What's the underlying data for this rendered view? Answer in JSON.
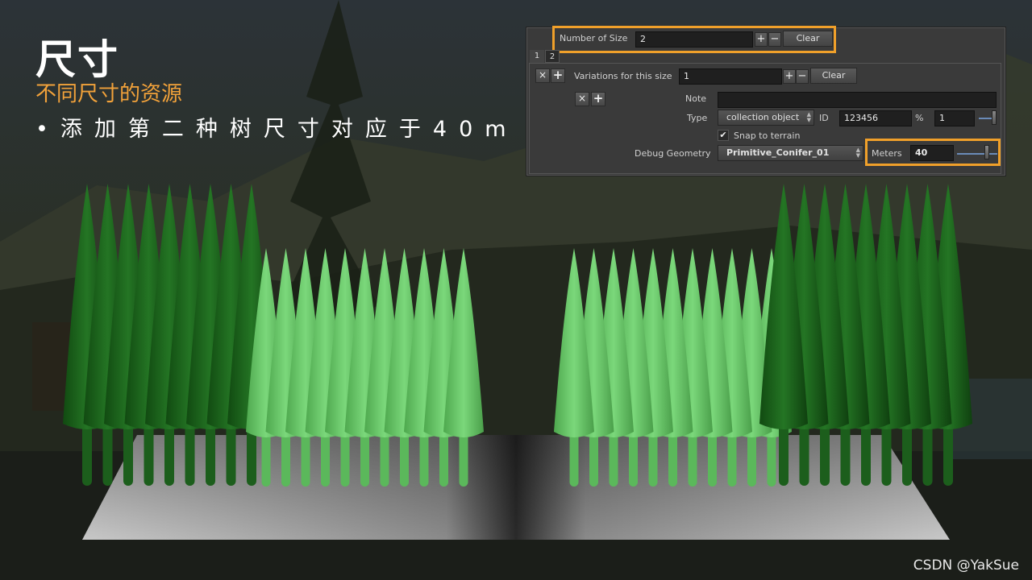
{
  "slide": {
    "title": "尺寸",
    "subtitle": "不同尺寸的资源",
    "bullet": "•添加第二种树尺寸对应于40m",
    "watermark": "CSDN @YakSue"
  },
  "panel": {
    "number_of_size_label": "Number of Size",
    "number_of_size_value": "2",
    "plus": "+",
    "minus": "−",
    "clear_label": "Clear",
    "tabs": [
      "1",
      "2"
    ],
    "x_glyph": "×",
    "variations_label": "Variations for this size",
    "variations_value": "1",
    "variations_clear_label": "Clear",
    "note_label": "Note",
    "note_value": "",
    "type_label": "Type",
    "type_value": "collection object",
    "id_label": "ID",
    "id_value": "123456",
    "percent_label": "%",
    "percent_value": "1",
    "snap_label": "Snap to terrain",
    "snap_checked": "✔",
    "debug_geometry_label": "Debug Geometry",
    "debug_geometry_value": "Primitive_Conifer_01",
    "meters_label": "Meters",
    "meters_value": "40"
  },
  "colors": {
    "highlight": "#f0a02a",
    "subtitle": "#f2a23a",
    "dark_tree": "#1f6a1f",
    "light_tree": "#6fcf6f"
  }
}
